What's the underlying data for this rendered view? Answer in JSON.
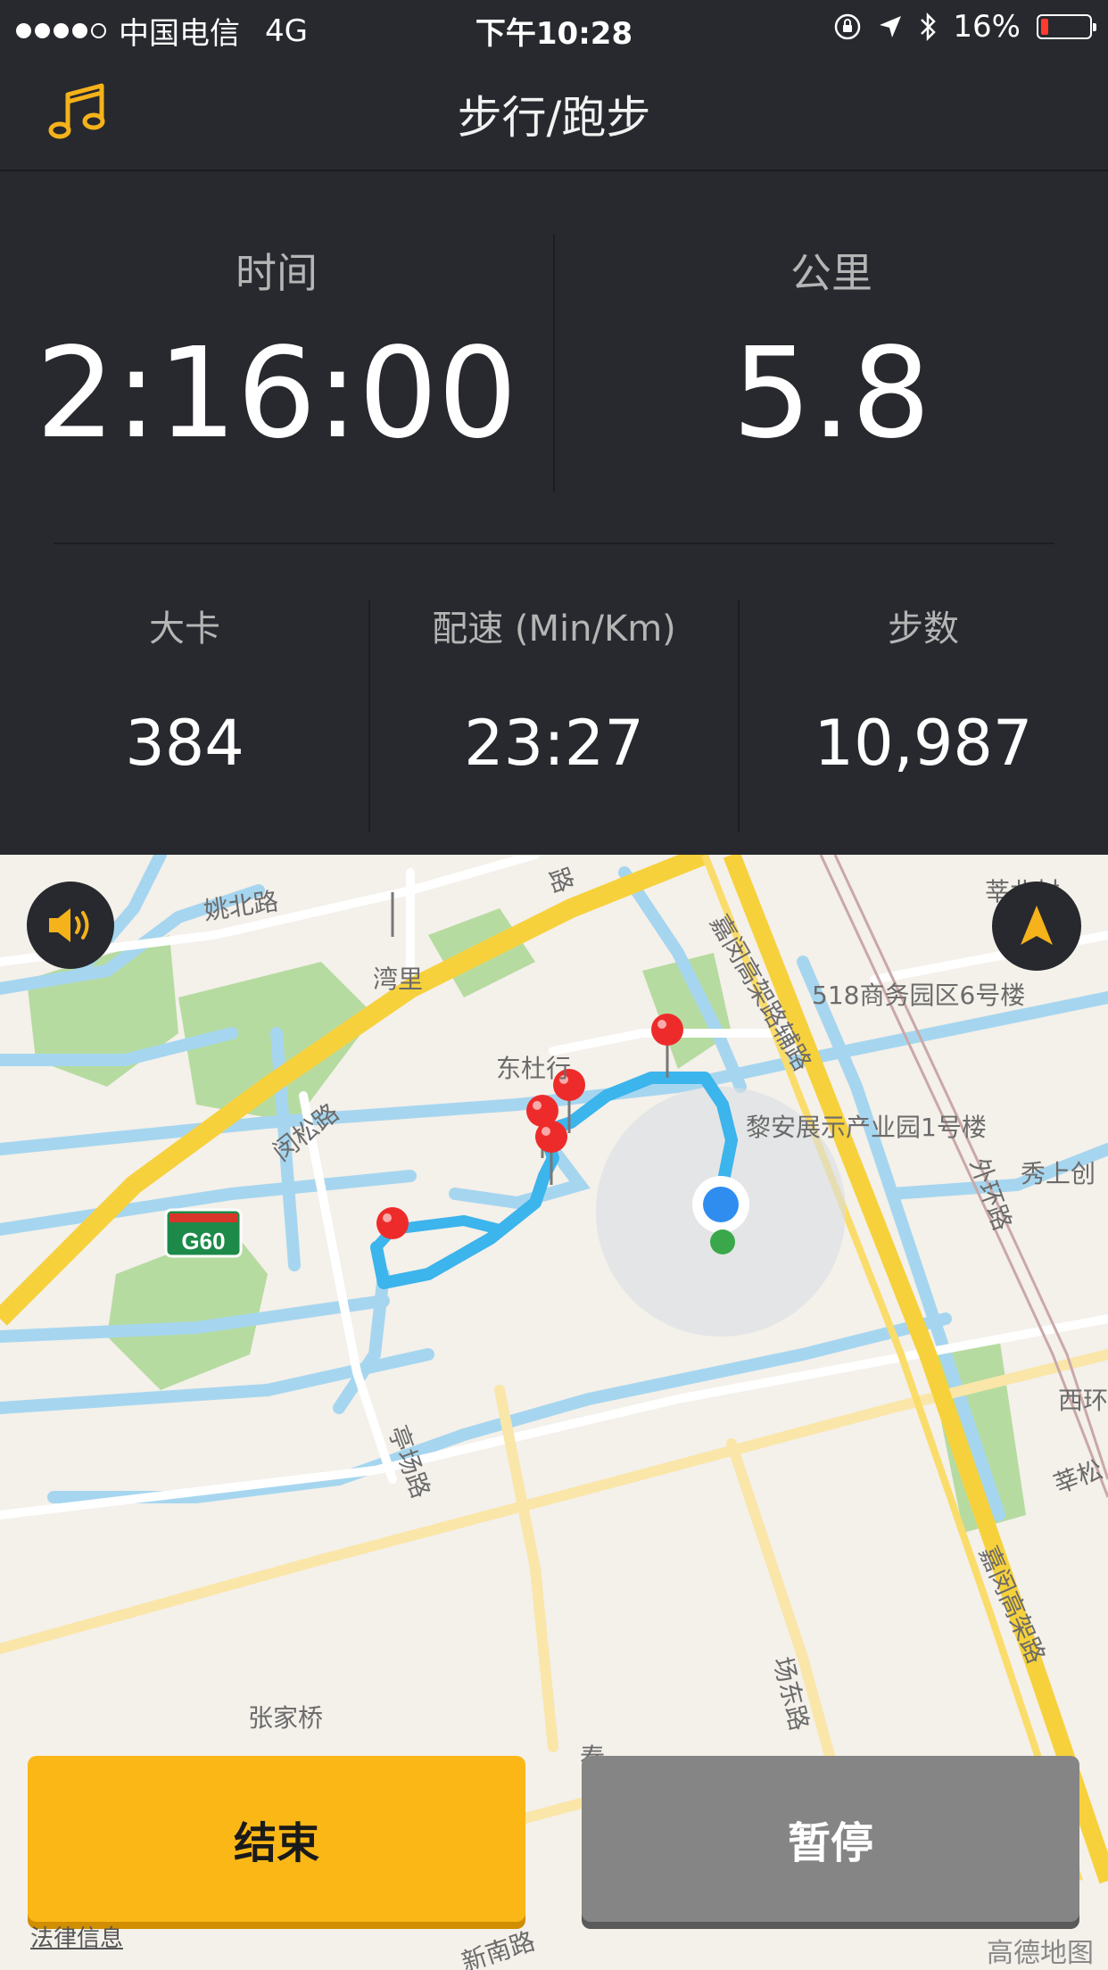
{
  "status_bar": {
    "carrier": "中国电信",
    "network": "4G",
    "time": "下午10:28",
    "battery": "16%",
    "battery_level": 0.16,
    "signal_bars": 4
  },
  "nav": {
    "title": "步行/跑步",
    "music_icon": "music-note-icon"
  },
  "stats": {
    "time_label": "时间",
    "time_value": "2:16:00",
    "distance_label": "公里",
    "distance_value": "5.8",
    "calories_label": "大卡",
    "calories_value": "384",
    "pace_label": "配速 (Min/Km)",
    "pace_value": "23:27",
    "steps_label": "步数",
    "steps_value": "10,987"
  },
  "map": {
    "labels": {
      "yaobei": "姚北路",
      "wanli": "湾里",
      "jiamin_fu": "嘉闵高架路辅路",
      "bldg518": "518商务园区6号楼",
      "dongduhang": "东杜行",
      "lian": "黎安展示产业园1号楼",
      "minsong": "闵松路",
      "xiushang": "秀上创",
      "waihuan": "外环路",
      "g60": "G60",
      "tingchang": "亭场路",
      "xihuan": "西环",
      "xinsong": "莘松",
      "jiamin": "嘉闵高架路",
      "zhangjiaqiao": "张家桥",
      "changdong": "场东路",
      "chun": "春",
      "xinnan": "新南路",
      "xinbei": "莘北村",
      "lu_top": "路"
    },
    "legal": "法律信息",
    "provider": "高德地图",
    "colors": {
      "route": "#3cb4ec",
      "water": "#a6d6ef",
      "park": "#b6dba0",
      "highway": "#f7d13c",
      "pin": "#ee2b2b"
    }
  },
  "buttons": {
    "end": "结束",
    "pause": "暂停",
    "volume_icon": "speaker-icon",
    "locate_icon": "navigation-arrow-icon"
  }
}
